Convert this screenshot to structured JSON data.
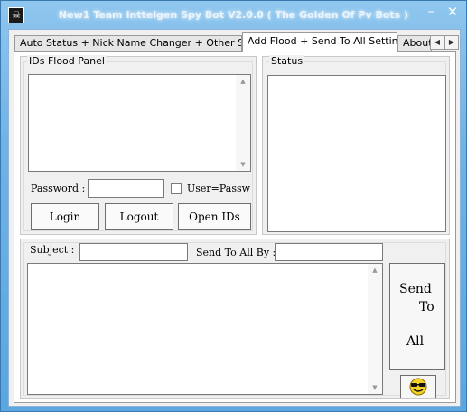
{
  "window": {
    "title": "New1 Team Inttelgen Spy Bot V2.0.0 ( The Golden Of Pv Bots )",
    "icon": "skull-icon",
    "minimize_glyph": "–",
    "close_glyph": "✕"
  },
  "tabs": [
    {
      "label": "Auto Status + Nick Name Changer + Other Settings",
      "active": false
    },
    {
      "label": "Add Flood + Send To All Settings",
      "active": true
    },
    {
      "label": "About",
      "active": false
    }
  ],
  "tab_scroll": {
    "left": "◀",
    "right": "▶"
  },
  "ids_panel": {
    "title": "IDs Flood Panel",
    "ids_text": "",
    "password_label": "Password :",
    "password_value": "",
    "checkbox_label": "User=Passw",
    "checkbox_checked": false,
    "buttons": {
      "login": "Login",
      "logout": "Logout",
      "open_ids": "Open IDs"
    }
  },
  "status_panel": {
    "title": "Status",
    "status_text": ""
  },
  "message_panel": {
    "subject_label": "Subject :",
    "subject_value": "",
    "send_by_label": "Send To All By :",
    "send_by_value": "",
    "message_text": "",
    "send_line1": "Send",
    "send_line2": "To",
    "send_line3": "All"
  },
  "scroll_arrows": {
    "up": "▲",
    "down": "▼"
  }
}
